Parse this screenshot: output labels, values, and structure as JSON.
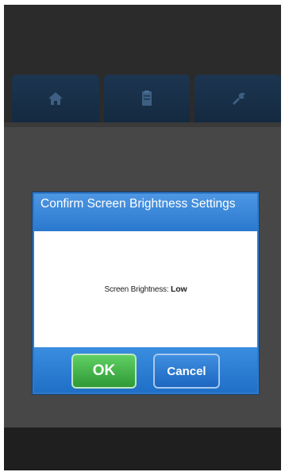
{
  "tabs": [
    {
      "icon": "home-icon"
    },
    {
      "icon": "document-icon"
    },
    {
      "icon": "settings-tools-icon"
    }
  ],
  "dialog": {
    "title": "Confirm Screen Brightness Settings",
    "message_label": "Screen Brightness:",
    "message_value": "Low",
    "ok_label": "OK",
    "cancel_label": "Cancel"
  },
  "colors": {
    "dialog_accent": "#2f79c9",
    "ok_button": "#3fae44",
    "cancel_button": "#2a78cf",
    "tab_bg": "#1c3550",
    "background": "#474747"
  }
}
